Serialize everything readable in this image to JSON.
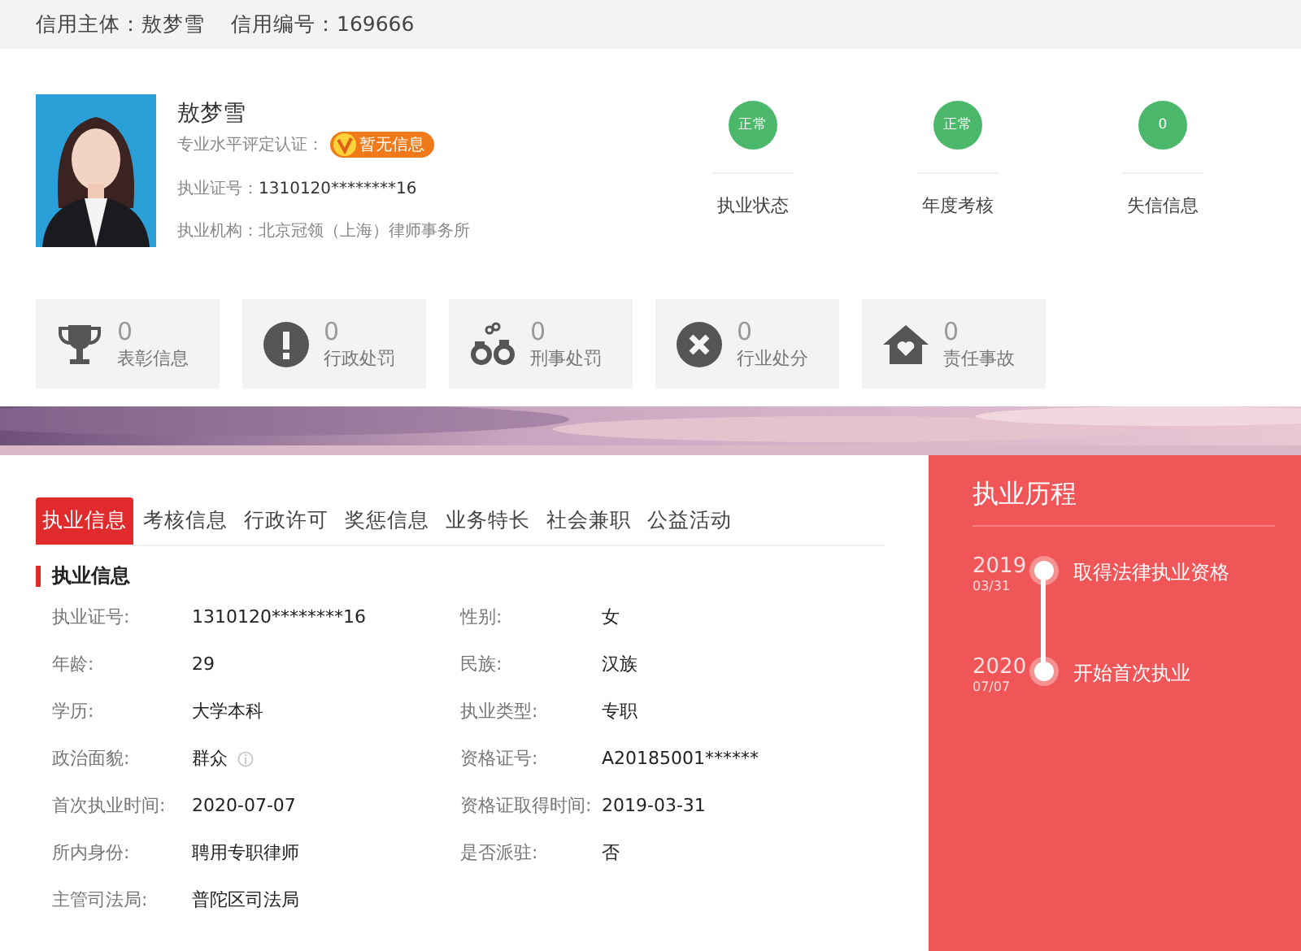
{
  "header": {
    "subject": "信用主体：敖梦雪",
    "credit_id": "信用编号：169666"
  },
  "profile": {
    "name": "敖梦雪",
    "cert_label": "专业水平评定认证：",
    "cert_badge": "暂无信息",
    "license_label": "执业证号：",
    "license": "1310120********16",
    "org_label": "执业机构：",
    "org": "北京冠领（上海）律师事务所"
  },
  "statuses": [
    {
      "value": "正常",
      "label": "执业状态"
    },
    {
      "value": "正常",
      "label": "年度考核"
    },
    {
      "value": "0",
      "label": "失信信息"
    }
  ],
  "stats": [
    {
      "kind": "trophy",
      "count": "0",
      "label": "表彰信息"
    },
    {
      "kind": "alert",
      "count": "0",
      "label": "行政处罚"
    },
    {
      "kind": "handcuffs",
      "count": "0",
      "label": "刑事处罚"
    },
    {
      "kind": "cross",
      "count": "0",
      "label": "行业处分"
    },
    {
      "kind": "house",
      "count": "0",
      "label": "责任事故"
    }
  ],
  "tabs": [
    {
      "label": "执业信息",
      "selected": true
    },
    {
      "label": "考核信息",
      "selected": false
    },
    {
      "label": "行政许可",
      "selected": false
    },
    {
      "label": "奖惩信息",
      "selected": false
    },
    {
      "label": "业务特长",
      "selected": false
    },
    {
      "label": "社会兼职",
      "selected": false
    },
    {
      "label": "公益活动",
      "selected": false
    }
  ],
  "section_title": "执业信息",
  "fields": [
    {
      "label": "执业证号:",
      "value": "1310120********16",
      "info_icon": false
    },
    {
      "label": "性别:",
      "value": "女",
      "info_icon": false
    },
    {
      "label": "年龄:",
      "value": "29",
      "info_icon": false
    },
    {
      "label": "民族:",
      "value": "汉族",
      "info_icon": false
    },
    {
      "label": "学历:",
      "value": "大学本科",
      "info_icon": false
    },
    {
      "label": "执业类型:",
      "value": "专职",
      "info_icon": false
    },
    {
      "label": "政治面貌:",
      "value": "群众",
      "info_icon": true
    },
    {
      "label": "资格证号:",
      "value": "A20185001******",
      "info_icon": false
    },
    {
      "label": "首次执业时间:",
      "value": "2020-07-07",
      "info_icon": false
    },
    {
      "label": "资格证取得时间:",
      "value": "2019-03-31",
      "info_icon": false
    },
    {
      "label": "所内身份:",
      "value": "聘用专职律师",
      "info_icon": false
    },
    {
      "label": "是否派驻:",
      "value": "否",
      "info_icon": false
    },
    {
      "label": "主管司法局:",
      "value": "普陀区司法局",
      "info_icon": false
    }
  ],
  "timeline": {
    "title": "执业历程",
    "events": [
      {
        "year": "2019",
        "date": "03/31",
        "text": "取得法律执业资格"
      },
      {
        "year": "2020",
        "date": "07/07",
        "text": "开始首次执业"
      }
    ]
  }
}
